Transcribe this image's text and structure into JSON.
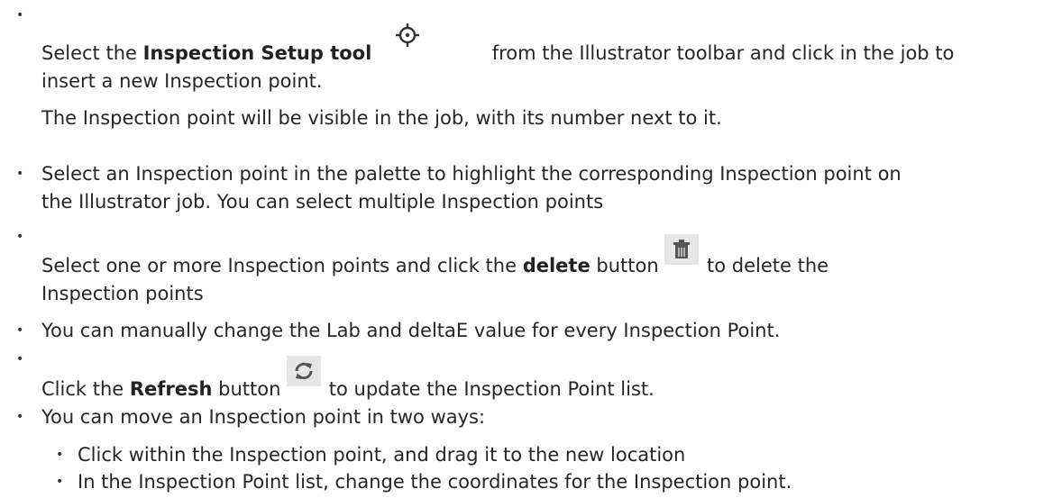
{
  "bullets": [
    {
      "line1_pre": "Select the ",
      "line1_bold": "Inspection Setup tool",
      "line1_post": "from the Illustrator toolbar and click in the job to",
      "line2": "insert a new Inspection point.",
      "note": "The Inspection point will be visible in the job, with its number next to it.",
      "icon": "crosshair-icon"
    },
    {
      "line1": "Select an Inspection point in the palette to highlight the corresponding Inspection point on",
      "line2": "the Illustrator job. You can select multiple Inspection points"
    },
    {
      "line1_pre": "Select one or more Inspection points and click the ",
      "line1_bold": "delete",
      "line1_mid": " button ",
      "line1_post": "to delete the",
      "line2": "Inspection points",
      "icon": "trash-icon"
    },
    {
      "line1": "You can manually change the Lab and deltaE value for every Inspection Point."
    },
    {
      "line1_pre": "Click the ",
      "line1_bold": "Refresh",
      "line1_mid": " button ",
      "line1_post": "to update the Inspection Point list.",
      "icon": "refresh-icon"
    },
    {
      "line1": "You can move an Inspection point in two ways:"
    }
  ],
  "sub_bullets": [
    "Click within the Inspection point, and drag it to the new location",
    "In the Inspection Point list, change the coordinates for the Inspection point."
  ],
  "bullet_glyph": "•",
  "colors": {
    "text": "#262626",
    "icon_bg": "#e6e6e6",
    "icon_fg": "#555555"
  }
}
